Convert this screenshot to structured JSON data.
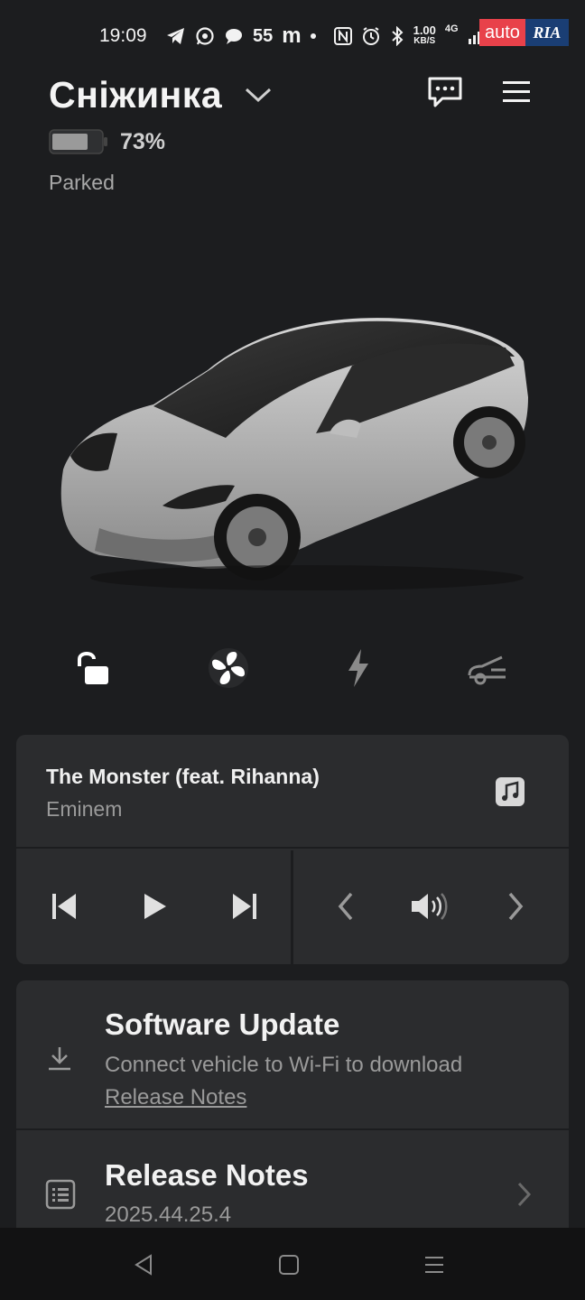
{
  "status_bar": {
    "time": "19:09",
    "notification_count": "55",
    "notification_letter": "m",
    "net_speed_value": "1.00",
    "net_speed_unit": "KB/S",
    "network_type": "4G"
  },
  "watermark": {
    "auto_text": "auto",
    "ria_text": "RIA"
  },
  "header": {
    "vehicle_name": "Сніжинка",
    "battery_percent": "73%",
    "battery_level": 0.73,
    "vehicle_state": "Parked"
  },
  "icons": {
    "lock": "unlock-icon",
    "climate": "fan-icon",
    "charge": "lightning-icon",
    "frunk": "frunk-icon",
    "messages": "message-icon",
    "menu": "menu-icon"
  },
  "media": {
    "song_title": "The Monster (feat. Rihanna)",
    "artist": "Eminem"
  },
  "software_update": {
    "title": "Software Update",
    "subtitle": "Connect vehicle to Wi-Fi to download",
    "link": "Release Notes"
  },
  "release_notes": {
    "title": "Release Notes",
    "version": "2025.44.25.4"
  },
  "colors": {
    "background": "#1c1d1f",
    "card": "#2b2c2e",
    "nav_bar": "#121213"
  }
}
